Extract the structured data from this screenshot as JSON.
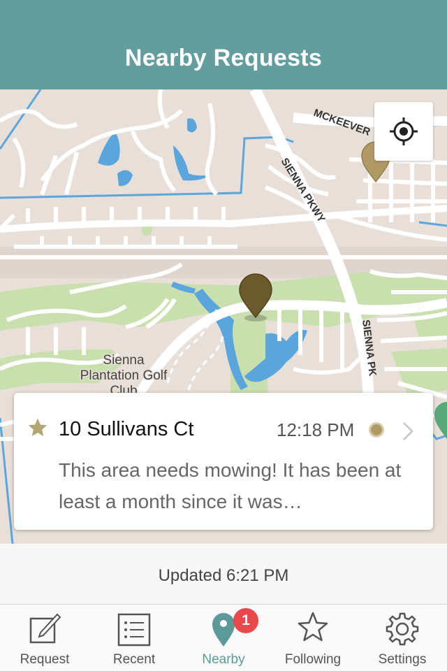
{
  "header": {
    "title": "Nearby Requests"
  },
  "map": {
    "road_labels": [
      "MCKEEVER",
      "SIENNA PKWY",
      "SIENNA PK"
    ],
    "place_label_lines": [
      "Sienna",
      "Plantation Golf",
      "Club"
    ]
  },
  "callout": {
    "address": "10 Sullivans Ct",
    "time": "12:18 PM",
    "description": "This area needs mowing! It has been at least a month since it was…"
  },
  "status": {
    "updated": "Updated 6:21 PM"
  },
  "tabs": [
    {
      "label": "Request",
      "icon": "compose-icon"
    },
    {
      "label": "Recent",
      "icon": "list-icon"
    },
    {
      "label": "Nearby",
      "icon": "map-pin-icon",
      "active": true
    },
    {
      "label": "Following",
      "icon": "star-icon",
      "badge": "1"
    },
    {
      "label": "Settings",
      "icon": "gear-icon"
    }
  ],
  "colors": {
    "header": "#639d9d",
    "active_tab": "#5c9a99",
    "pin_dark": "#6b5a2c",
    "pin_light": "#b09a63",
    "star": "#b1a670",
    "badge": "#e8474c",
    "water": "#5aa6dc",
    "park": "#c9dfae"
  }
}
